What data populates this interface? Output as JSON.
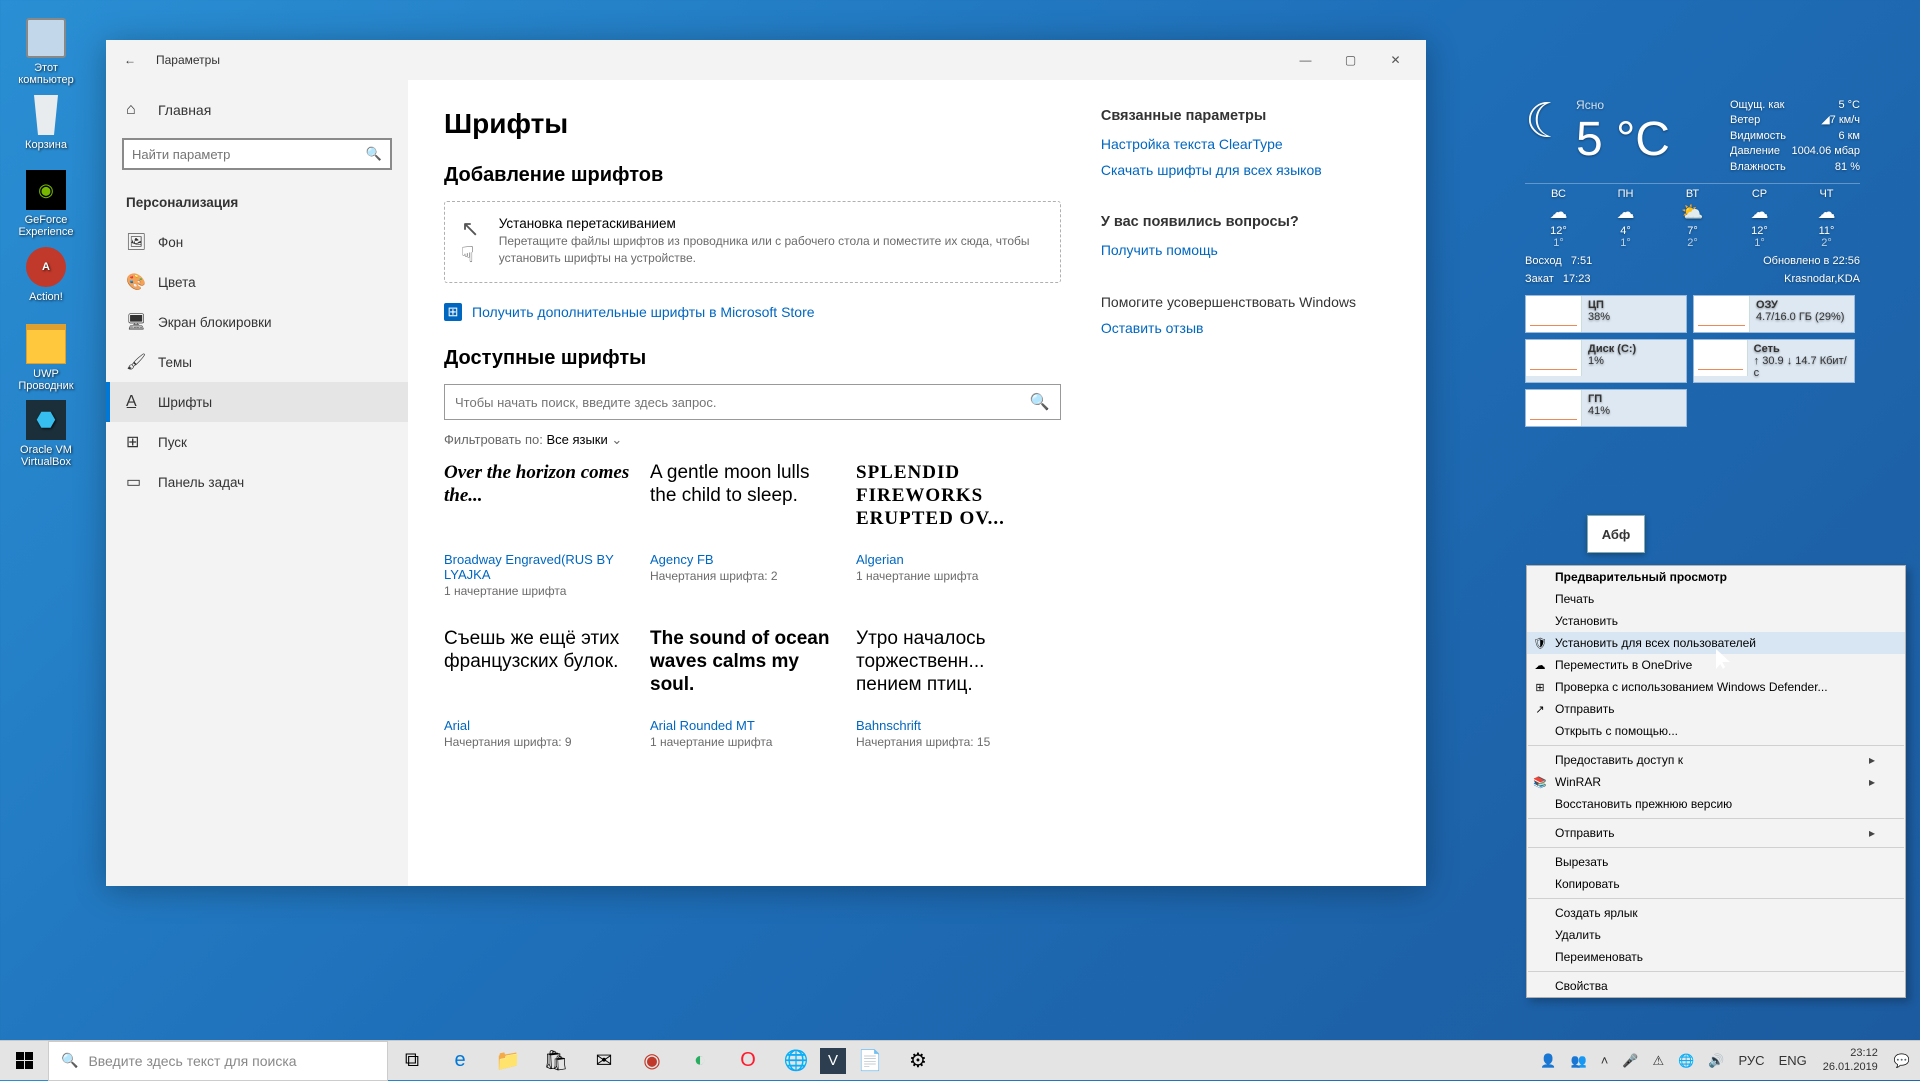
{
  "desktop": {
    "computer": "Этот\nкомпьютер",
    "recycle": "Корзина",
    "geforce": "GeForce\nExperience",
    "action": "Action!",
    "uwp": "UWP\nПроводник",
    "vbox": "Oracle VM\nVirtualBox"
  },
  "window": {
    "title": "Параметры",
    "search_placeholder": "Найти параметр",
    "home": "Главная",
    "category": "Персонализация",
    "nav": {
      "background": "Фон",
      "colors": "Цвета",
      "lockscreen": "Экран блокировки",
      "themes": "Темы",
      "fonts": "Шрифты",
      "start": "Пуск",
      "taskbar": "Панель задач"
    },
    "page_title": "Шрифты",
    "add_heading": "Добавление шрифтов",
    "drop_title": "Установка перетаскиванием",
    "drop_sub": "Перетащите файлы шрифтов из проводника или с рабочего стола и поместите их сюда, чтобы установить шрифты на устройстве.",
    "ms_store_link": "Получить дополнительные шрифты в Microsoft Store",
    "available_heading": "Доступные шрифты",
    "font_search_placeholder": "Чтобы начать поиск, введите здесь запрос.",
    "filter_label": "Фильтровать по: ",
    "filter_value": "Все языки",
    "fonts": [
      {
        "sample": "Over the horizon comes the...",
        "name": "Broadway Engraved(RUS BY LYAJKA",
        "meta": "1 начертание шрифта",
        "cls": "f-broadway"
      },
      {
        "sample": "A gentle moon lulls the child to sleep.",
        "name": "Agency FB",
        "meta": "Начертания шрифта: 2",
        "cls": "f-agency"
      },
      {
        "sample": "SPLENDID FIREWORKS ERUPTED OV...",
        "name": "Algerian",
        "meta": "1 начертание шрифта",
        "cls": "f-algerian"
      },
      {
        "sample": "Съешь же ещё этих французских булок.",
        "name": "Arial",
        "meta": "Начертания шрифта: 9",
        "cls": "f-arial"
      },
      {
        "sample": "The sound of ocean waves calms my soul.",
        "name": "Arial Rounded MT",
        "meta": "1 начертание шрифта",
        "cls": "f-rounded"
      },
      {
        "sample": "Утро началось торжественн... пением птиц.",
        "name": "Bahnschrift",
        "meta": "Начертания шрифта: 15",
        "cls": "f-bahn"
      }
    ],
    "aside": {
      "related_h": "Связанные параметры",
      "cleartype": "Настройка текста ClearType",
      "download_all": "Скачать шрифты для всех языков",
      "questions_h": "У вас появились вопросы?",
      "get_help": "Получить помощь",
      "improve_h": "Помогите усовершенствовать Windows",
      "feedback": "Оставить отзыв"
    }
  },
  "gadget": {
    "cond": "Ясно",
    "temp": "5 °C",
    "rows": {
      "feels_l": "Ощущ. как",
      "feels_v": "5 °C",
      "wind_l": "Ветер",
      "wind_v": "◢7 км/ч",
      "vis_l": "Видимость",
      "vis_v": "6 км",
      "pres_l": "Давление",
      "pres_v": "1004.06 мбар",
      "hum_l": "Влажность",
      "hum_v": "81 %"
    },
    "days": [
      "ВС",
      "ПН",
      "ВТ",
      "СР",
      "ЧТ"
    ],
    "icons": [
      "☁",
      "☁",
      "⛅",
      "☁",
      "☁"
    ],
    "hi": [
      "12°",
      "4°",
      "7°",
      "12°",
      "11°"
    ],
    "lo": [
      "1°",
      "1°",
      "2°",
      "1°",
      "2°"
    ],
    "sunrise_l": "Восход",
    "sunrise_v": "7:51",
    "sunset_l": "Закат",
    "sunset_v": "17:23",
    "updated_l": "Обновлено в",
    "updated_v": "22:56",
    "location": "Krasnodar,KDA",
    "perf": {
      "cpu_n": "ЦП",
      "cpu_v": "38%",
      "ram_n": "ОЗУ",
      "ram_v": "4.7/16.0 ГБ (29%)",
      "disk_n": "Диск (C:)",
      "disk_v": "1%",
      "net_n": "Сеть",
      "net_v": "↑ 30.9 ↓ 14.7 Кбит/с",
      "gpu_n": "ГП",
      "gpu_v": "41%"
    }
  },
  "font_file_label": "Абф",
  "ctx": {
    "preview": "Предварительный просмотр",
    "print": "Печать",
    "install": "Установить",
    "install_all": "Установить для всех пользователей",
    "onedrive": "Переместить в OneDrive",
    "defender": "Проверка с использованием Windows Defender...",
    "send": "Отправить",
    "openwith": "Открыть с помощью...",
    "access": "Предоставить доступ к",
    "winrar": "WinRAR",
    "restore": "Восстановить прежнюю версию",
    "sendto": "Отправить",
    "cut": "Вырезать",
    "copy": "Копировать",
    "shortcut": "Создать ярлык",
    "delete": "Удалить",
    "rename": "Переименовать",
    "properties": "Свойства"
  },
  "taskbar": {
    "search_placeholder": "Введите здесь текст для поиска",
    "lang1": "РУС",
    "lang2": "ENG",
    "time": "23:12",
    "date": "26.01.2019"
  }
}
